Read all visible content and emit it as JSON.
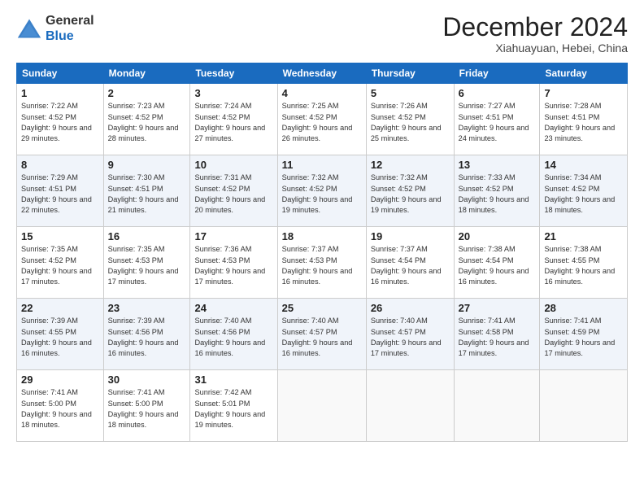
{
  "header": {
    "logo_general": "General",
    "logo_blue": "Blue",
    "month_title": "December 2024",
    "location": "Xiahuayuan, Hebei, China"
  },
  "calendar": {
    "days_of_week": [
      "Sunday",
      "Monday",
      "Tuesday",
      "Wednesday",
      "Thursday",
      "Friday",
      "Saturday"
    ],
    "weeks": [
      [
        null,
        {
          "day": "2",
          "sunrise": "7:23 AM",
          "sunset": "4:52 PM",
          "daylight": "9 hours and 28 minutes."
        },
        {
          "day": "3",
          "sunrise": "7:24 AM",
          "sunset": "4:52 PM",
          "daylight": "9 hours and 27 minutes."
        },
        {
          "day": "4",
          "sunrise": "7:25 AM",
          "sunset": "4:52 PM",
          "daylight": "9 hours and 26 minutes."
        },
        {
          "day": "5",
          "sunrise": "7:26 AM",
          "sunset": "4:52 PM",
          "daylight": "9 hours and 25 minutes."
        },
        {
          "day": "6",
          "sunrise": "7:27 AM",
          "sunset": "4:51 PM",
          "daylight": "9 hours and 24 minutes."
        },
        {
          "day": "7",
          "sunrise": "7:28 AM",
          "sunset": "4:51 PM",
          "daylight": "9 hours and 23 minutes."
        }
      ],
      [
        {
          "day": "1",
          "sunrise": "7:22 AM",
          "sunset": "4:52 PM",
          "daylight": "9 hours and 29 minutes."
        },
        {
          "day": "9",
          "sunrise": "7:30 AM",
          "sunset": "4:51 PM",
          "daylight": "9 hours and 21 minutes."
        },
        {
          "day": "10",
          "sunrise": "7:31 AM",
          "sunset": "4:52 PM",
          "daylight": "9 hours and 20 minutes."
        },
        {
          "day": "11",
          "sunrise": "7:32 AM",
          "sunset": "4:52 PM",
          "daylight": "9 hours and 19 minutes."
        },
        {
          "day": "12",
          "sunrise": "7:32 AM",
          "sunset": "4:52 PM",
          "daylight": "9 hours and 19 minutes."
        },
        {
          "day": "13",
          "sunrise": "7:33 AM",
          "sunset": "4:52 PM",
          "daylight": "9 hours and 18 minutes."
        },
        {
          "day": "14",
          "sunrise": "7:34 AM",
          "sunset": "4:52 PM",
          "daylight": "9 hours and 18 minutes."
        }
      ],
      [
        {
          "day": "8",
          "sunrise": "7:29 AM",
          "sunset": "4:51 PM",
          "daylight": "9 hours and 22 minutes."
        },
        {
          "day": "16",
          "sunrise": "7:35 AM",
          "sunset": "4:53 PM",
          "daylight": "9 hours and 17 minutes."
        },
        {
          "day": "17",
          "sunrise": "7:36 AM",
          "sunset": "4:53 PM",
          "daylight": "9 hours and 17 minutes."
        },
        {
          "day": "18",
          "sunrise": "7:37 AM",
          "sunset": "4:53 PM",
          "daylight": "9 hours and 16 minutes."
        },
        {
          "day": "19",
          "sunrise": "7:37 AM",
          "sunset": "4:54 PM",
          "daylight": "9 hours and 16 minutes."
        },
        {
          "day": "20",
          "sunrise": "7:38 AM",
          "sunset": "4:54 PM",
          "daylight": "9 hours and 16 minutes."
        },
        {
          "day": "21",
          "sunrise": "7:38 AM",
          "sunset": "4:55 PM",
          "daylight": "9 hours and 16 minutes."
        }
      ],
      [
        {
          "day": "15",
          "sunrise": "7:35 AM",
          "sunset": "4:52 PM",
          "daylight": "9 hours and 17 minutes."
        },
        {
          "day": "23",
          "sunrise": "7:39 AM",
          "sunset": "4:56 PM",
          "daylight": "9 hours and 16 minutes."
        },
        {
          "day": "24",
          "sunrise": "7:40 AM",
          "sunset": "4:56 PM",
          "daylight": "9 hours and 16 minutes."
        },
        {
          "day": "25",
          "sunrise": "7:40 AM",
          "sunset": "4:57 PM",
          "daylight": "9 hours and 16 minutes."
        },
        {
          "day": "26",
          "sunrise": "7:40 AM",
          "sunset": "4:57 PM",
          "daylight": "9 hours and 17 minutes."
        },
        {
          "day": "27",
          "sunrise": "7:41 AM",
          "sunset": "4:58 PM",
          "daylight": "9 hours and 17 minutes."
        },
        {
          "day": "28",
          "sunrise": "7:41 AM",
          "sunset": "4:59 PM",
          "daylight": "9 hours and 17 minutes."
        }
      ],
      [
        {
          "day": "22",
          "sunrise": "7:39 AM",
          "sunset": "4:55 PM",
          "daylight": "9 hours and 16 minutes."
        },
        {
          "day": "30",
          "sunrise": "7:41 AM",
          "sunset": "5:00 PM",
          "daylight": "9 hours and 18 minutes."
        },
        {
          "day": "31",
          "sunrise": "7:42 AM",
          "sunset": "5:01 PM",
          "daylight": "9 hours and 19 minutes."
        },
        null,
        null,
        null,
        null
      ],
      [
        {
          "day": "29",
          "sunrise": "7:41 AM",
          "sunset": "5:00 PM",
          "daylight": "9 hours and 18 minutes."
        },
        null,
        null,
        null,
        null,
        null,
        null
      ]
    ]
  }
}
